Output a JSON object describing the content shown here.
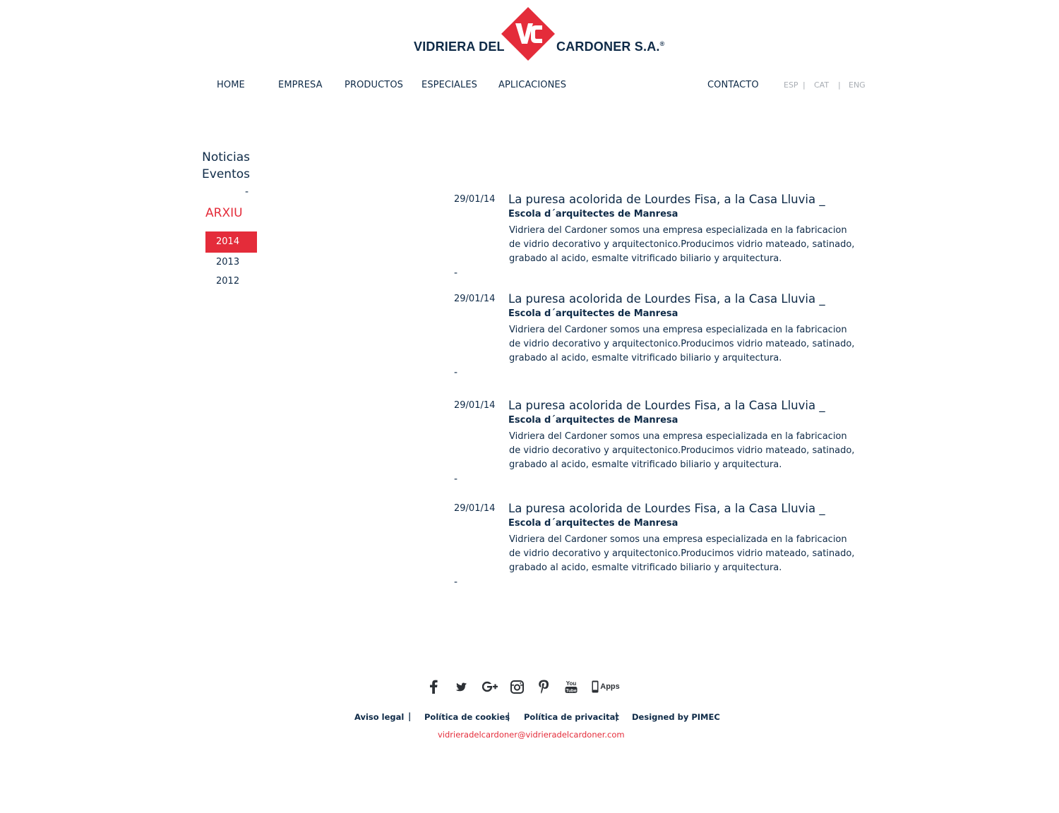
{
  "brand": {
    "name_left": "VIDRIERA DEL",
    "name_right": "CARDONER S.A.",
    "registered_mark": "®",
    "colors": {
      "navy": "#0e2a47",
      "red": "#e42c3a"
    }
  },
  "nav": {
    "items": [
      "HOME",
      "EMPRESA",
      "PRODUCTOS",
      "ESPECIALES",
      "APLICACIONES"
    ],
    "contact": "CONTACTO",
    "languages": [
      "ESP",
      "CAT",
      "ENG"
    ],
    "lang_separator": "|"
  },
  "sidebar": {
    "noticias": "Noticias",
    "eventos": "Eventos",
    "dash": "-",
    "archive_title": "ARXIU",
    "years": [
      "2014",
      "2013",
      "2012"
    ],
    "active_year": "2014"
  },
  "news": [
    {
      "date": "29/01/14",
      "title": "La puresa acolorida de Lourdes Fisa, a la Casa Lluvia _",
      "location": "Escola d´arquitectes de Manresa",
      "body": "Vidriera del Cardoner somos una empresa especializada en la fabricacion de vidrio decorativo y arquitectonico.Producimos vidrio mateado, satinado, grabado al acido, esmalte vitrificado biliario y arquitectura.",
      "dash": "-"
    },
    {
      "date": "29/01/14",
      "title": "La puresa acolorida de Lourdes Fisa, a la Casa Lluvia _",
      "location": "Escola d´arquitectes de Manresa",
      "body": "Vidriera del Cardoner somos una empresa especializada en la fabricacion de vidrio decorativo y arquitectonico.Producimos vidrio mateado, satinado, grabado al acido, esmalte vitrificado biliario y arquitectura.",
      "dash": "-"
    },
    {
      "date": "29/01/14",
      "title": "La puresa acolorida de Lourdes Fisa, a la Casa Lluvia _",
      "location": "Escola d´arquitectes de Manresa",
      "body": "Vidriera del Cardoner somos una empresa especializada en la fabricacion de vidrio decorativo y arquitectonico.Producimos vidrio mateado, satinado, grabado al acido, esmalte vitrificado biliario y arquitectura.",
      "dash": "-"
    },
    {
      "date": "29/01/14",
      "title": "La puresa acolorida de Lourdes Fisa, a la Casa Lluvia _",
      "location": "Escola d´arquitectes de Manresa",
      "body": "Vidriera del Cardoner somos una empresa especializada en la fabricacion de vidrio decorativo y arquitectonico.Producimos vidrio mateado, satinado, grabado al acido, esmalte vitrificado biliario y arquitectura.",
      "dash": "-"
    }
  ],
  "footer": {
    "social": [
      "facebook-icon",
      "twitter-icon",
      "google-plus-icon",
      "instagram-icon",
      "pinterest-icon",
      "youtube-icon",
      "apps-icon"
    ],
    "youtube_label": "You Tube",
    "apps_label": "Apps",
    "links": [
      "Aviso legal",
      "Política de cookies",
      "Política de privacitat",
      "Designed by PIMEC"
    ],
    "separator": "|",
    "email": "vidrieradelcardoner@vidrieradelcardoner.com"
  }
}
